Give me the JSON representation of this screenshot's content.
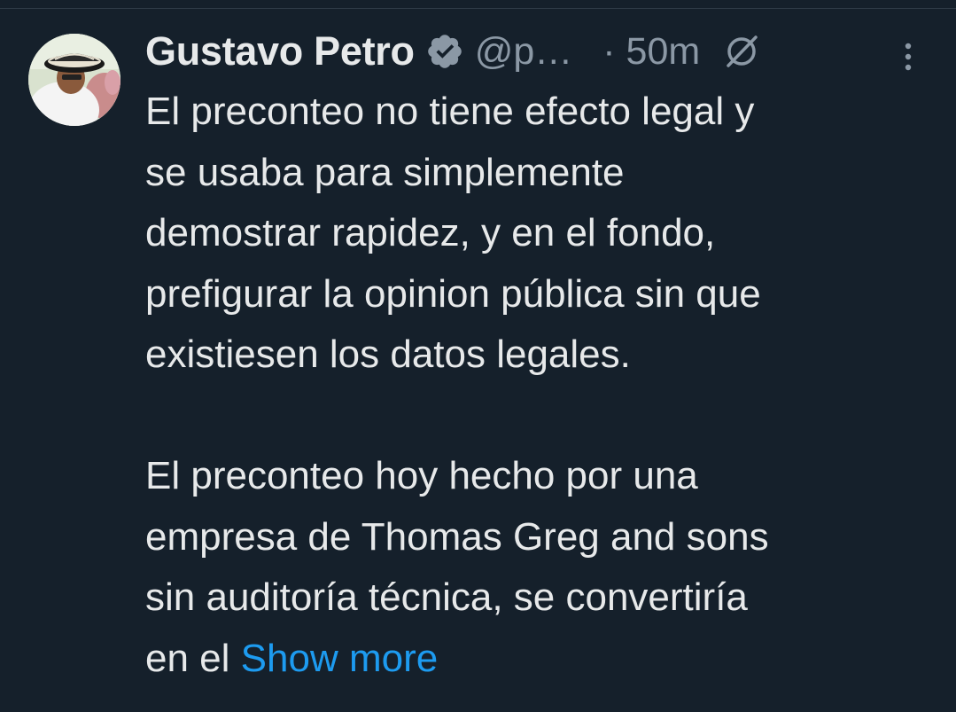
{
  "tweet": {
    "author": {
      "display_name": "Gustavo Petro",
      "handle": "@p…",
      "verified_icon": "verified-badge-icon",
      "avatar_icon": "avatar-photo"
    },
    "time": "· 50m",
    "grok_icon": "grok-slash-icon",
    "more_icon": "more-vertical-icon",
    "paragraphs": [
      [
        "El preconteo no tiene efecto legal y",
        "se usaba para simplemente",
        "demostrar rapidez, y en el fondo,",
        "prefigurar la opinion pública sin que",
        "existiesen los datos legales."
      ],
      [
        "El preconteo hoy hecho por una",
        "empresa de Thomas Greg and sons",
        "sin auditoría técnica, se convertiría",
        "en el"
      ]
    ],
    "show_more_label": "Show more",
    "colors": {
      "background": "#15202b",
      "text": "#e7e9ea",
      "secondary": "#8b98a5",
      "link": "#1d9bf0"
    }
  }
}
